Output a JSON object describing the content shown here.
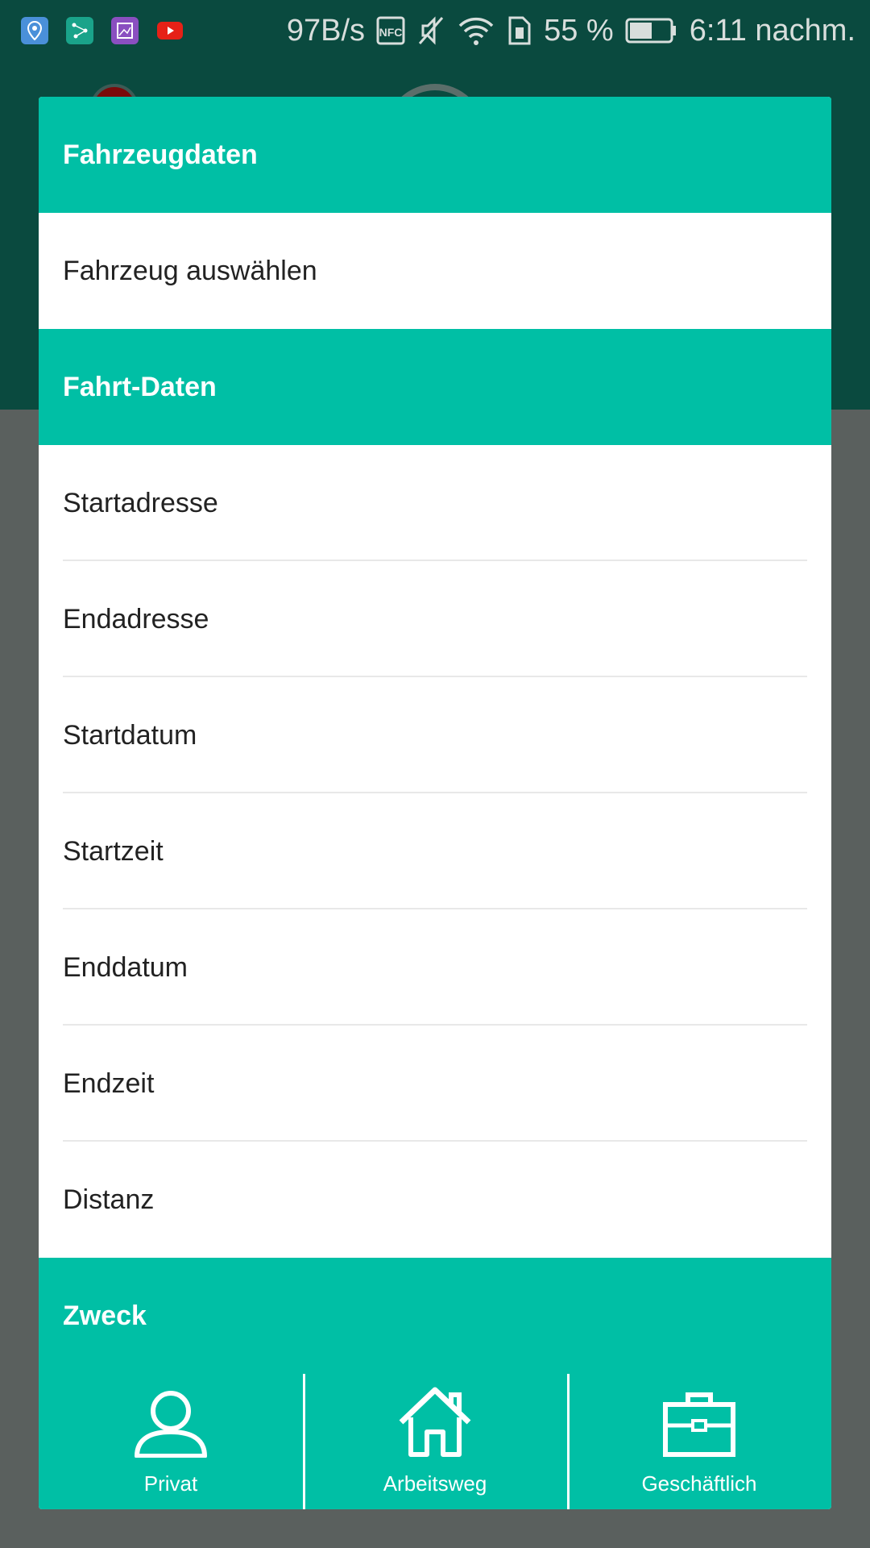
{
  "statusbar": {
    "speed": "97B/s",
    "battery": "55 %",
    "time": "6:11 nachm."
  },
  "dialog": {
    "vehicle_header": "Fahrzeugdaten",
    "vehicle_select": "Fahrzeug auswählen",
    "trip_header": "Fahrt-Daten",
    "trip_items": [
      {
        "label": "Startadresse"
      },
      {
        "label": "Endadresse"
      },
      {
        "label": "Startdatum"
      },
      {
        "label": "Startzeit"
      },
      {
        "label": "Enddatum"
      },
      {
        "label": "Endzeit"
      },
      {
        "label": "Distanz"
      }
    ],
    "purpose_header": "Zweck",
    "purpose_options": [
      {
        "label": "Privat",
        "icon": "person-icon"
      },
      {
        "label": "Arbeitsweg",
        "icon": "house-icon"
      },
      {
        "label": "Geschäftlich",
        "icon": "briefcase-icon"
      }
    ]
  },
  "colors": {
    "accent": "#00bfa5",
    "header_dark": "#0a4a3f",
    "scrim": "#5a605e"
  }
}
